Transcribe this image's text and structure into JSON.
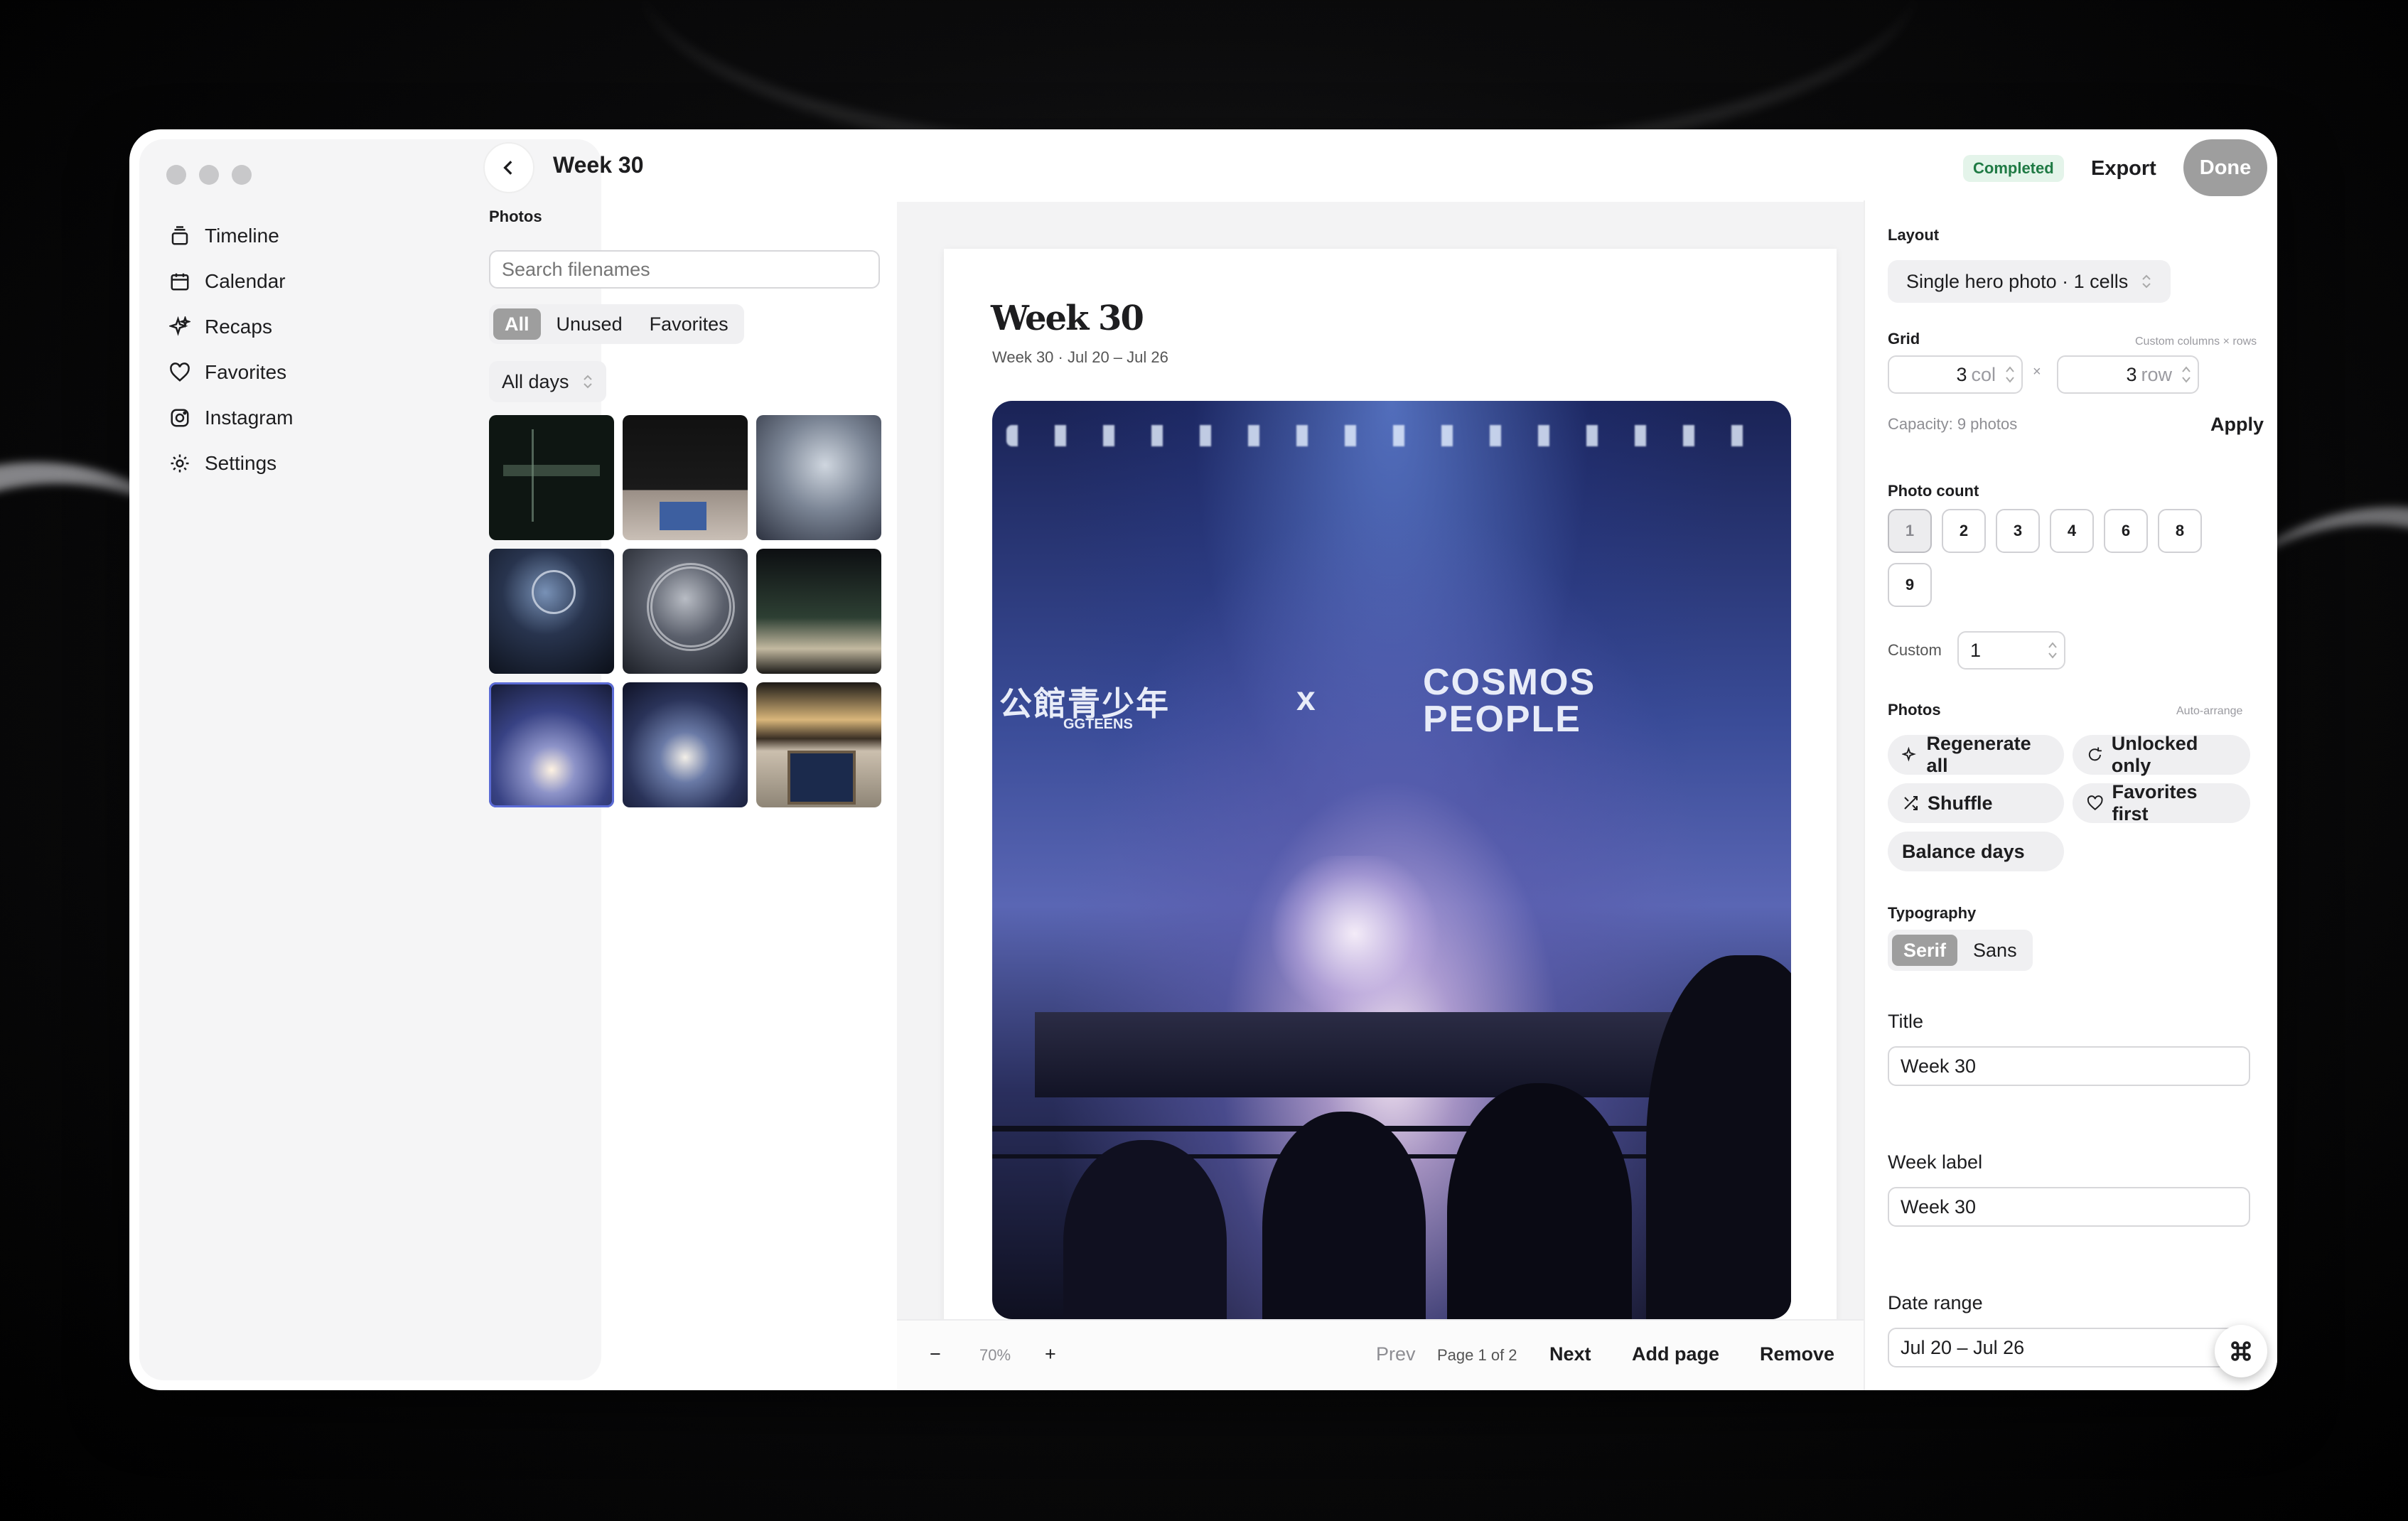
{
  "sidebar": {
    "items": [
      {
        "label": "Timeline",
        "icon": "timeline-icon"
      },
      {
        "label": "Calendar",
        "icon": "calendar-icon"
      },
      {
        "label": "Recaps",
        "icon": "sparkles-icon"
      },
      {
        "label": "Favorites",
        "icon": "heart-icon"
      },
      {
        "label": "Instagram",
        "icon": "instagram-icon"
      },
      {
        "label": "Settings",
        "icon": "gear-icon"
      }
    ]
  },
  "header": {
    "title": "Week 30",
    "status": "Completed",
    "export_label": "Export",
    "done_label": "Done"
  },
  "photos_panel": {
    "label": "Photos",
    "search_placeholder": "Search filenames",
    "filters": [
      "All",
      "Unused",
      "Favorites"
    ],
    "active_filter": "All",
    "days_select": "All days"
  },
  "page": {
    "heading": "Week 30",
    "subtitle": "Week 30 · Jul 20 – Jul 26",
    "hero_banner_left": "公館青少年",
    "hero_banner_left_sub": "GGTEENS",
    "hero_banner_x": "x",
    "hero_banner_right_1": "COSMOS",
    "hero_banner_right_2": "PEOPLE"
  },
  "toolbar": {
    "zoom_out": "−",
    "zoom": "70%",
    "zoom_in": "+",
    "prev": "Prev",
    "page_indicator": "Page 1 of 2",
    "next": "Next",
    "add_page": "Add page",
    "remove": "Remove"
  },
  "right_panel": {
    "layout_label": "Layout",
    "layout_value": "Single hero photo · 1 cells",
    "grid_label": "Grid",
    "grid_hint": "Custom columns × rows",
    "grid_cols": "3",
    "grid_cols_unit": "col",
    "grid_times": "×",
    "grid_rows": "3",
    "grid_rows_unit": "row",
    "capacity": "Capacity: 9 photos",
    "apply_label": "Apply",
    "photo_count_label": "Photo count",
    "photo_counts": [
      "1",
      "2",
      "3",
      "4",
      "6",
      "8",
      "9"
    ],
    "photo_count_selected": "1",
    "custom_label": "Custom",
    "custom_value": "1",
    "photos_label": "Photos",
    "photos_hint": "Auto-arrange",
    "actions": {
      "regenerate": "Regenerate all",
      "unlocked": "Unlocked only",
      "shuffle": "Shuffle",
      "favorites_first": "Favorites first",
      "balance": "Balance days"
    },
    "typography_label": "Typography",
    "typography_options": [
      "Serif",
      "Sans"
    ],
    "typography_selected": "Serif",
    "title_label": "Title",
    "title_value": "Week 30",
    "week_label_label": "Week label",
    "week_label_value": "Week 30",
    "date_range_label": "Date range",
    "date_range_value": "Jul 20 – Jul 26"
  },
  "colors": {
    "accent_gray": "#9e9e9e",
    "status_green": "#1f7a44",
    "stage_blue": "#3b4f9e"
  }
}
